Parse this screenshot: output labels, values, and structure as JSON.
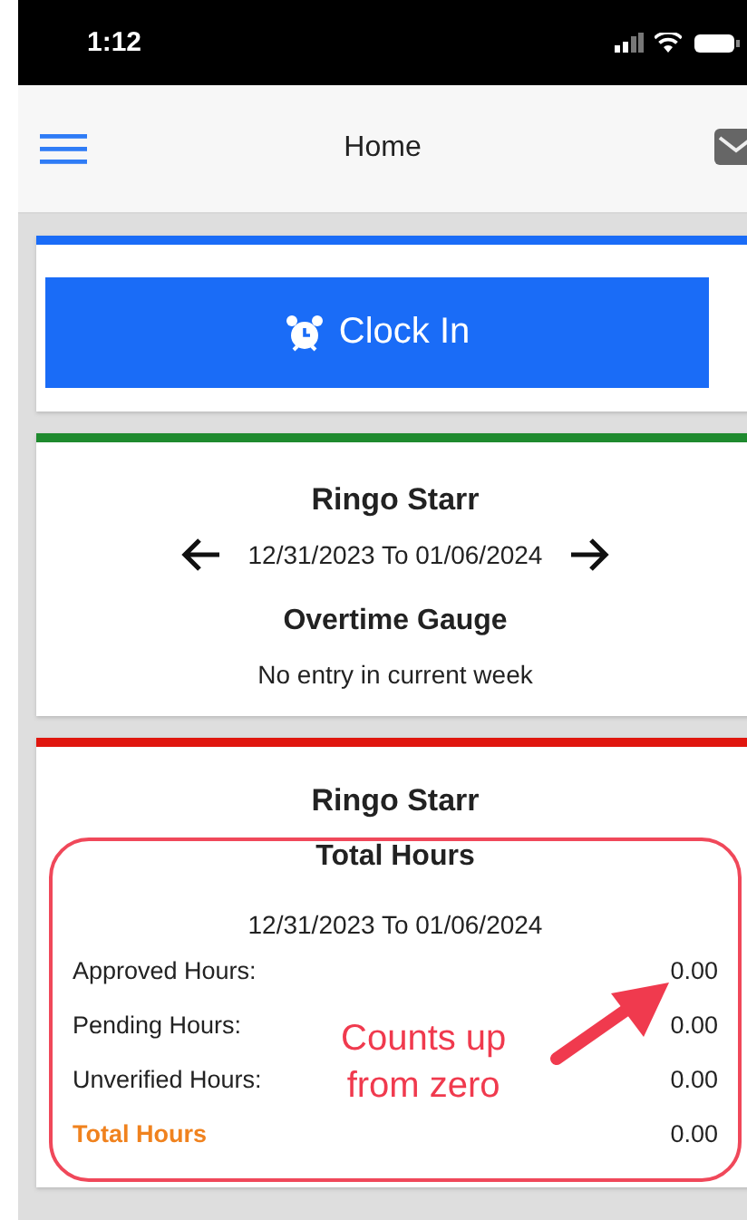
{
  "status_bar": {
    "time": "1:12"
  },
  "nav_bar": {
    "title": "Home"
  },
  "clock_card": {
    "button": "Clock In"
  },
  "overtime_card": {
    "name": "Ringo Starr",
    "date_range": "12/31/2023 To 01/06/2024",
    "heading": "Overtime Gauge",
    "message": "No entry in current week"
  },
  "hours_card": {
    "name": "Ringo Starr",
    "heading": "Total Hours",
    "date_range": "12/31/2023 To 01/06/2024",
    "rows": [
      {
        "kind": "regular",
        "label": "Approved Hours:",
        "value": "0.00"
      },
      {
        "kind": "regular",
        "label": "Pending Hours:",
        "value": "0.00"
      },
      {
        "kind": "regular",
        "label": "Unverified Hours:",
        "value": "0.00"
      },
      {
        "kind": "total",
        "label": "Total Hours",
        "value": "0.00"
      }
    ]
  },
  "annotation": {
    "lines": [
      "Counts up",
      "from zero"
    ]
  }
}
